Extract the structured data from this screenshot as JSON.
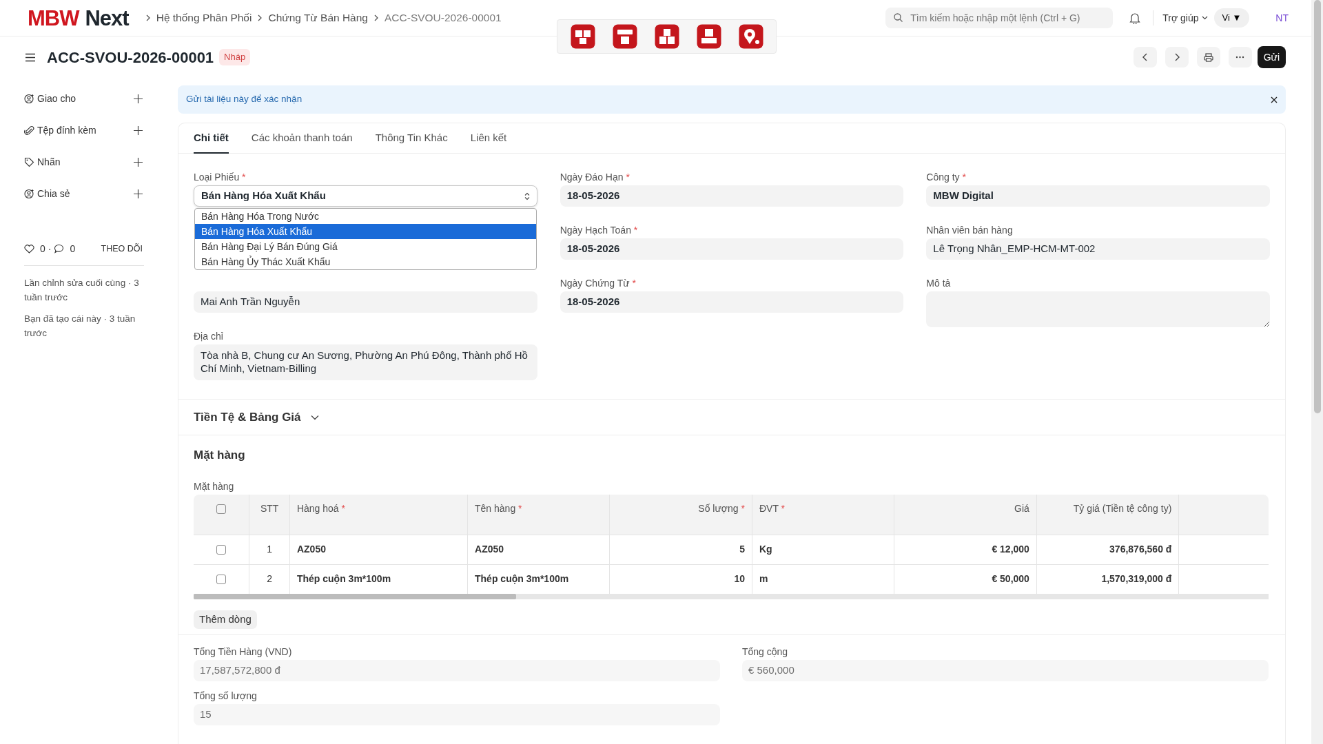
{
  "header": {
    "logo": {
      "brand": "MBW",
      "suffix": "Next"
    },
    "breadcrumbs": [
      "Hệ thống Phân Phối",
      "Chứng Từ Bán Hàng",
      "ACC-SVOU-2026-00001"
    ],
    "search": {
      "placeholder": "Tìm kiếm hoặc nhập một lệnh (Ctrl + G)"
    },
    "help": "Trợ giúp",
    "language": {
      "label": "Vi",
      "caret": "▼"
    },
    "avatar": "NT"
  },
  "title_bar": {
    "title": "ACC-SVOU-2026-00001",
    "status": "Nháp",
    "primary_button": "Gửi"
  },
  "sidebar": {
    "items": [
      {
        "label": "Giao cho",
        "kind": "user"
      },
      {
        "label": "Tệp đính kèm",
        "kind": "attachment"
      },
      {
        "label": "Nhãn",
        "kind": "tag"
      },
      {
        "label": "Chia sẻ",
        "kind": "user"
      }
    ],
    "reactions": {
      "likes": "0",
      "separator": "·",
      "comments": "0"
    },
    "follow": "THEO DÕI",
    "activity": [
      "Lần chỉnh sửa cuối cùng · 3 tuần trước",
      "Bạn đã tạo cái này · 3 tuần trước"
    ]
  },
  "alert": {
    "message": "Gửi tài liệu này để xác nhận"
  },
  "tabs": [
    {
      "label": "Chi tiết",
      "selected": true
    },
    {
      "label": "Các khoản thanh toán",
      "selected": false
    },
    {
      "label": "Thông Tin Khác",
      "selected": false
    },
    {
      "label": "Liên kết",
      "selected": false
    }
  ],
  "form": {
    "columns": [
      [
        {
          "kind": "select",
          "label": "Loại Phiếu",
          "required_mark": "*",
          "value": "Bán Hàng Hóa Xuất Khẩu",
          "bold": true,
          "open": true,
          "options": [
            {
              "label": "Bán Hàng Hóa Trong Nước",
              "selected": false
            },
            {
              "label": "Bán Hàng Hóa Xuất Khẩu",
              "selected": true
            },
            {
              "label": "Bán Hàng Đại Lý Bán Đúng Giá",
              "selected": false
            },
            {
              "label": "Bán Hàng Ủy Thác Xuất Khẩu",
              "selected": false
            }
          ]
        },
        {
          "kind": "input",
          "value": "Mai Anh Trần Nguyễn",
          "bold": false
        },
        {
          "kind": "textarea",
          "label": "Địa chỉ",
          "value": "Tòa nhà B, Chung cư An Sương, Phường An Phú Đông, Thành phố Hồ Chí Minh, Vietnam-Billing"
        }
      ],
      [
        {
          "kind": "input",
          "label": "Ngày Đáo Hạn",
          "required_mark": "*",
          "value": "18-05-2026",
          "bold": true
        },
        {
          "kind": "input",
          "label": "Ngày Hạch Toán",
          "required_mark": "*",
          "value": "18-05-2026",
          "bold": true
        },
        {
          "kind": "input",
          "label": "Ngày Chứng Từ",
          "required_mark": "*",
          "value": "18-05-2026",
          "bold": true
        }
      ],
      [
        {
          "kind": "input",
          "label": "Công ty",
          "required_mark": "*",
          "value": "MBW Digital",
          "bold": true
        },
        {
          "kind": "input",
          "label": "Nhân viên bán hàng",
          "value": "Lê Trọng Nhân_EMP-HCM-MT-002",
          "bold": false
        },
        {
          "kind": "textarea",
          "label": "Mô tả"
        }
      ]
    ]
  },
  "currency_section": {
    "title": "Tiền Tệ & Bảng Giá",
    "expanded": false
  },
  "items_section": {
    "title": "Mặt hàng",
    "table_label": "Mặt hàng",
    "table": {
      "select_all_checked": false,
      "columns": [
        {
          "label": "STT"
        },
        {
          "label": "Hàng hoá",
          "required_mark": "*"
        },
        {
          "label": "Tên hàng",
          "required_mark": "*"
        },
        {
          "label": "Số lượng",
          "required_mark": "*"
        },
        {
          "label": "ĐVT",
          "required_mark": "*"
        },
        {
          "label": "Giá"
        },
        {
          "label": "Tỷ giá (Tiền tệ công ty)"
        }
      ],
      "rows": [
        {
          "checked": false,
          "cells": [
            "1",
            "AZ050",
            "AZ050",
            "5",
            "Kg",
            "€ 12,000",
            "376,876,560 đ"
          ]
        },
        {
          "checked": false,
          "cells": [
            "2",
            "Thép cuộn 3m*100m",
            "Thép cuộn 3m*100m",
            "10",
            "m",
            "€ 50,000",
            "1,570,319,000 đ"
          ]
        }
      ]
    },
    "add_row_button": "Thêm dòng"
  },
  "totals": [
    {
      "label": "Tổng Tiền Hàng (VND)",
      "value": "17,587,572,800 đ"
    },
    {
      "label": "Tổng cộng",
      "value": "€ 560,000"
    },
    {
      "label": "Tổng số lượng",
      "value": "15"
    }
  ]
}
